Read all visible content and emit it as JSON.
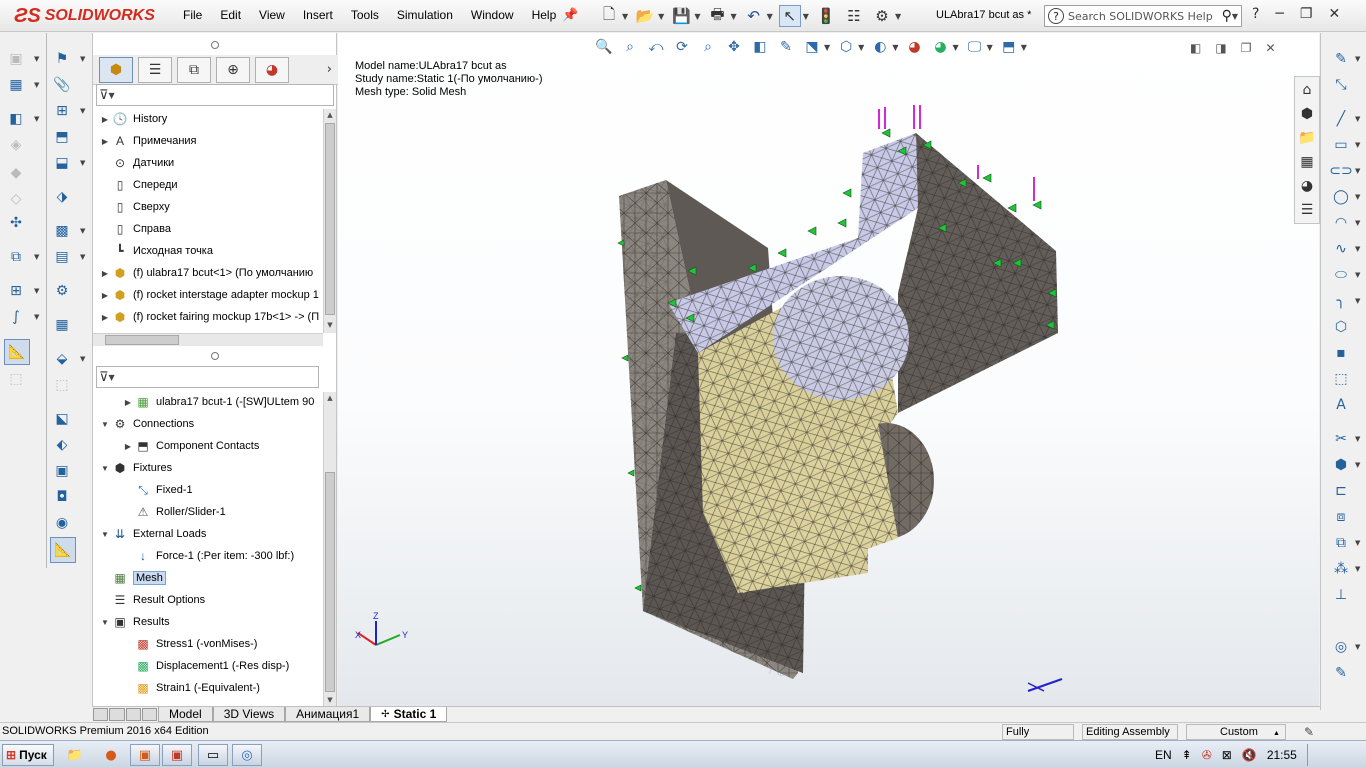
{
  "app": {
    "logo_text": "SOLIDWORKS",
    "menu": [
      "File",
      "Edit",
      "View",
      "Insert",
      "Tools",
      "Simulation",
      "Window",
      "Help"
    ],
    "document_title": "ULAbra17 bcut as *",
    "search_placeholder": "Search SOLIDWORKS Help",
    "quick_icons": [
      "new-document-icon",
      "open-icon",
      "save-icon",
      "print-icon",
      "undo-icon",
      "select-icon",
      "rebuild-icon",
      "file-properties-icon",
      "options-icon"
    ]
  },
  "feature_tree": {
    "tabs": [
      "feature-manager-icon",
      "property-manager-icon",
      "configuration-manager-icon",
      "dim-xpert-icon",
      "display-manager-icon"
    ],
    "items": [
      {
        "label": "History",
        "icon": "history-icon",
        "toggle": "▶"
      },
      {
        "label": "Примечания",
        "icon": "annotations-icon",
        "toggle": "▶"
      },
      {
        "label": "Датчики",
        "icon": "sensors-icon",
        "toggle": ""
      },
      {
        "label": "Спереди",
        "icon": "plane-icon",
        "toggle": ""
      },
      {
        "label": "Сверху",
        "icon": "plane-icon",
        "toggle": ""
      },
      {
        "label": "Справа",
        "icon": "plane-icon",
        "toggle": ""
      },
      {
        "label": "Исходная точка",
        "icon": "origin-icon",
        "toggle": ""
      },
      {
        "label": "(f) ulabra17 bcut<1> (По умолчанию",
        "icon": "part-icon",
        "toggle": "▶"
      },
      {
        "label": "(f) rocket interstage adapter mockup 1",
        "icon": "part-icon",
        "toggle": "▶"
      },
      {
        "label": "(f) rocket fairing mockup 17b<1> -> (П",
        "icon": "part-icon",
        "toggle": "▶"
      }
    ]
  },
  "simulation_tree": {
    "items": [
      {
        "label": "ulabra17 bcut-1 (-[SW]ULtem 90",
        "icon": "mesh-part-icon",
        "toggle": "▶",
        "indent": 1
      },
      {
        "label": "Connections",
        "icon": "connections-icon",
        "toggle": "▼",
        "indent": 0
      },
      {
        "label": "Component Contacts",
        "icon": "contacts-icon",
        "toggle": "▶",
        "indent": 1
      },
      {
        "label": "Fixtures",
        "icon": "fixtures-icon",
        "toggle": "▼",
        "indent": 0
      },
      {
        "label": "Fixed-1",
        "icon": "fixed-icon",
        "toggle": "",
        "indent": 1
      },
      {
        "label": "Roller/Slider-1",
        "icon": "roller-slider-icon",
        "toggle": "",
        "indent": 1
      },
      {
        "label": "External Loads",
        "icon": "external-loads-icon",
        "toggle": "▼",
        "indent": 0
      },
      {
        "label": "Force-1 (:Per item: -300 lbf:)",
        "icon": "force-icon",
        "toggle": "",
        "indent": 1
      },
      {
        "label": "Mesh",
        "icon": "mesh-icon",
        "toggle": "",
        "indent": 0,
        "selected": true
      },
      {
        "label": "Result Options",
        "icon": "result-options-icon",
        "toggle": "",
        "indent": 0
      },
      {
        "label": "Results",
        "icon": "results-folder-icon",
        "toggle": "▼",
        "indent": 0
      },
      {
        "label": "Stress1 (-vonMises-)",
        "icon": "stress-plot-icon",
        "toggle": "",
        "indent": 1
      },
      {
        "label": "Displacement1 (-Res disp-)",
        "icon": "displacement-plot-icon",
        "toggle": "",
        "indent": 1
      },
      {
        "label": "Strain1 (-Equivalent-)",
        "icon": "strain-plot-icon",
        "toggle": "",
        "indent": 1
      }
    ]
  },
  "viewport": {
    "info_lines": [
      "Model name:ULAbra17 bcut as",
      "Study name:Static 1(-По умолчанию-)",
      "Mesh type: Solid Mesh"
    ],
    "triad": {
      "x": "X",
      "y": "Y",
      "z": "Z"
    },
    "headsup_icons": [
      "zoom-to-fit-icon",
      "zoom-area-icon",
      "previous-view-icon",
      "rotate-icon",
      "zoom-icon",
      "pan-icon",
      "section-view-icon",
      "view-orientation-icon",
      "display-style-icon",
      "hide-show-icon",
      "edit-appearance-icon",
      "apply-scene-icon",
      "view-settings-icon",
      "simulation-display-icon"
    ]
  },
  "bottom_tabs": [
    "Model",
    "3D Views",
    "Анимация1",
    "Static 1"
  ],
  "active_tab": "Static 1",
  "status": {
    "edition": "SOLIDWORKS Premium 2016 x64 Edition",
    "state": "Fully Defined",
    "mode": "Editing Assembly",
    "units": "Custom"
  },
  "taskbar": {
    "start_label": "Пуск",
    "language": "EN",
    "time": "21:55"
  },
  "colors": {
    "accent": "#d52b1e",
    "selection": "#c9dcf3",
    "mesh_grey": "#8c8680",
    "mesh_face_grey": "#5e5954",
    "mesh_lilac": "#c7c9e6",
    "mesh_tan": "#d9cf9a",
    "fixture_green": "#22c33a",
    "load_magenta": "#d02bd8"
  }
}
